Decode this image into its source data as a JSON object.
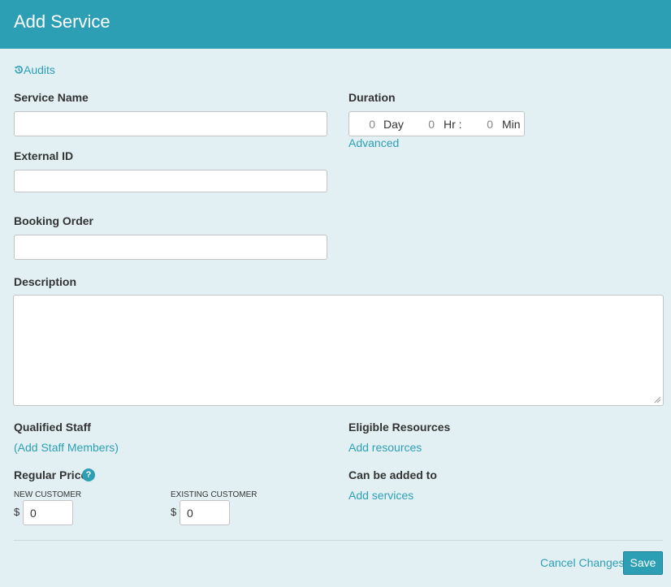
{
  "header": {
    "title": "Add Service"
  },
  "audits": {
    "icon": "history-icon",
    "label": "Audits"
  },
  "service_name": {
    "label": "Service Name",
    "value": ""
  },
  "external_id": {
    "label": "External ID",
    "value": ""
  },
  "booking_order": {
    "label": "Booking Order",
    "value": ""
  },
  "description": {
    "label": "Description",
    "value": ""
  },
  "duration": {
    "label": "Duration",
    "day_value": "0",
    "day_unit": "Day",
    "hr_value": "0",
    "hr_unit": "Hr :",
    "min_value": "0",
    "min_unit": "Min",
    "advanced_link": "Advanced"
  },
  "qualified_staff": {
    "label": "Qualified Staff",
    "link": "(Add Staff Members)"
  },
  "eligible_resources": {
    "label": "Eligible Resources",
    "link": "Add resources"
  },
  "regular_price": {
    "label": "Regular Price",
    "help_icon": "question-icon",
    "help_glyph": "?",
    "new_customer_label": "NEW CUSTOMER",
    "new_customer_currency": "$",
    "new_customer_value": "0",
    "existing_customer_label": "EXISTING CUSTOMER",
    "existing_customer_currency": "$",
    "existing_customer_value": "0"
  },
  "can_be_added_to": {
    "label": "Can be added to",
    "link": "Add services"
  },
  "footer": {
    "cancel_label": "Cancel Changes",
    "save_label": "Save"
  },
  "colors": {
    "accent": "#2d9fb4",
    "background": "#e2f0f3",
    "text": "#333333"
  }
}
